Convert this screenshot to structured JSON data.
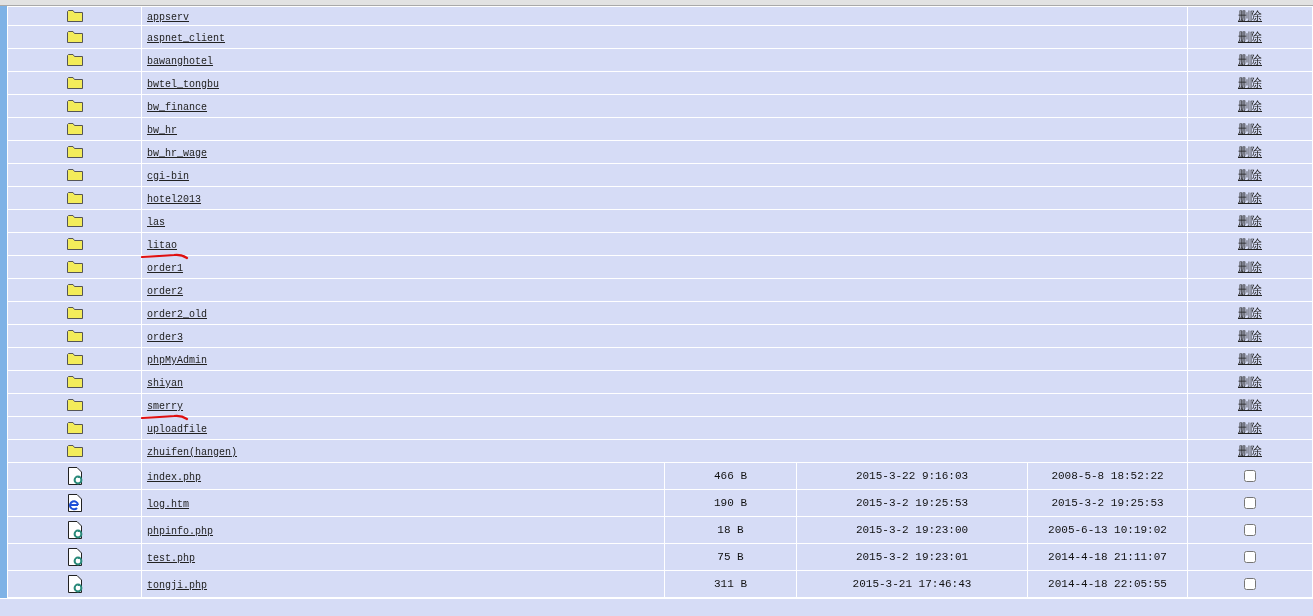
{
  "folders": [
    {
      "name": "appserv",
      "action": "删除",
      "marked": false
    },
    {
      "name": "aspnet_client",
      "action": "删除",
      "marked": false
    },
    {
      "name": "bawanghotel",
      "action": "删除",
      "marked": false
    },
    {
      "name": "bwtel_tongbu",
      "action": "删除",
      "marked": false
    },
    {
      "name": "bw_finance",
      "action": "删除",
      "marked": false
    },
    {
      "name": "bw_hr",
      "action": "删除",
      "marked": false
    },
    {
      "name": "bw_hr_wage",
      "action": "删除",
      "marked": false
    },
    {
      "name": "cgi-bin",
      "action": "删除",
      "marked": false
    },
    {
      "name": "hotel2013",
      "action": "删除",
      "marked": false
    },
    {
      "name": "las",
      "action": "删除",
      "marked": false
    },
    {
      "name": "litao",
      "action": "删除",
      "marked": true
    },
    {
      "name": "order1",
      "action": "删除",
      "marked": false
    },
    {
      "name": "order2",
      "action": "删除",
      "marked": false
    },
    {
      "name": "order2_old",
      "action": "删除",
      "marked": false
    },
    {
      "name": "order3",
      "action": "删除",
      "marked": false
    },
    {
      "name": "phpMyAdmin",
      "action": "删除",
      "marked": false
    },
    {
      "name": "shiyan",
      "action": "删除",
      "marked": false
    },
    {
      "name": "smerry",
      "action": "删除",
      "marked": true
    },
    {
      "name": "uploadfile",
      "action": "删除",
      "marked": false
    },
    {
      "name": "zhuifen(hangen)",
      "action": "删除",
      "marked": false
    }
  ],
  "files": [
    {
      "kind": "php",
      "name": "index.php",
      "size": "466 B",
      "modified": "2015-3-22 9:16:03",
      "created": "2008-5-8 18:52:22",
      "checked": false
    },
    {
      "kind": "htm",
      "name": "log.htm",
      "size": "190 B",
      "modified": "2015-3-2 19:25:53",
      "created": "2015-3-2 19:25:53",
      "checked": false
    },
    {
      "kind": "php",
      "name": "phpinfo.php",
      "size": "18 B",
      "modified": "2015-3-2 19:23:00",
      "created": "2005-6-13 10:19:02",
      "checked": false
    },
    {
      "kind": "php",
      "name": "test.php",
      "size": "75 B",
      "modified": "2015-3-2 19:23:01",
      "created": "2014-4-18 21:11:07",
      "checked": false
    },
    {
      "kind": "php",
      "name": "tongji.php",
      "size": "311 B",
      "modified": "2015-3-21 17:46:43",
      "created": "2014-4-18 22:05:55",
      "checked": false
    }
  ]
}
